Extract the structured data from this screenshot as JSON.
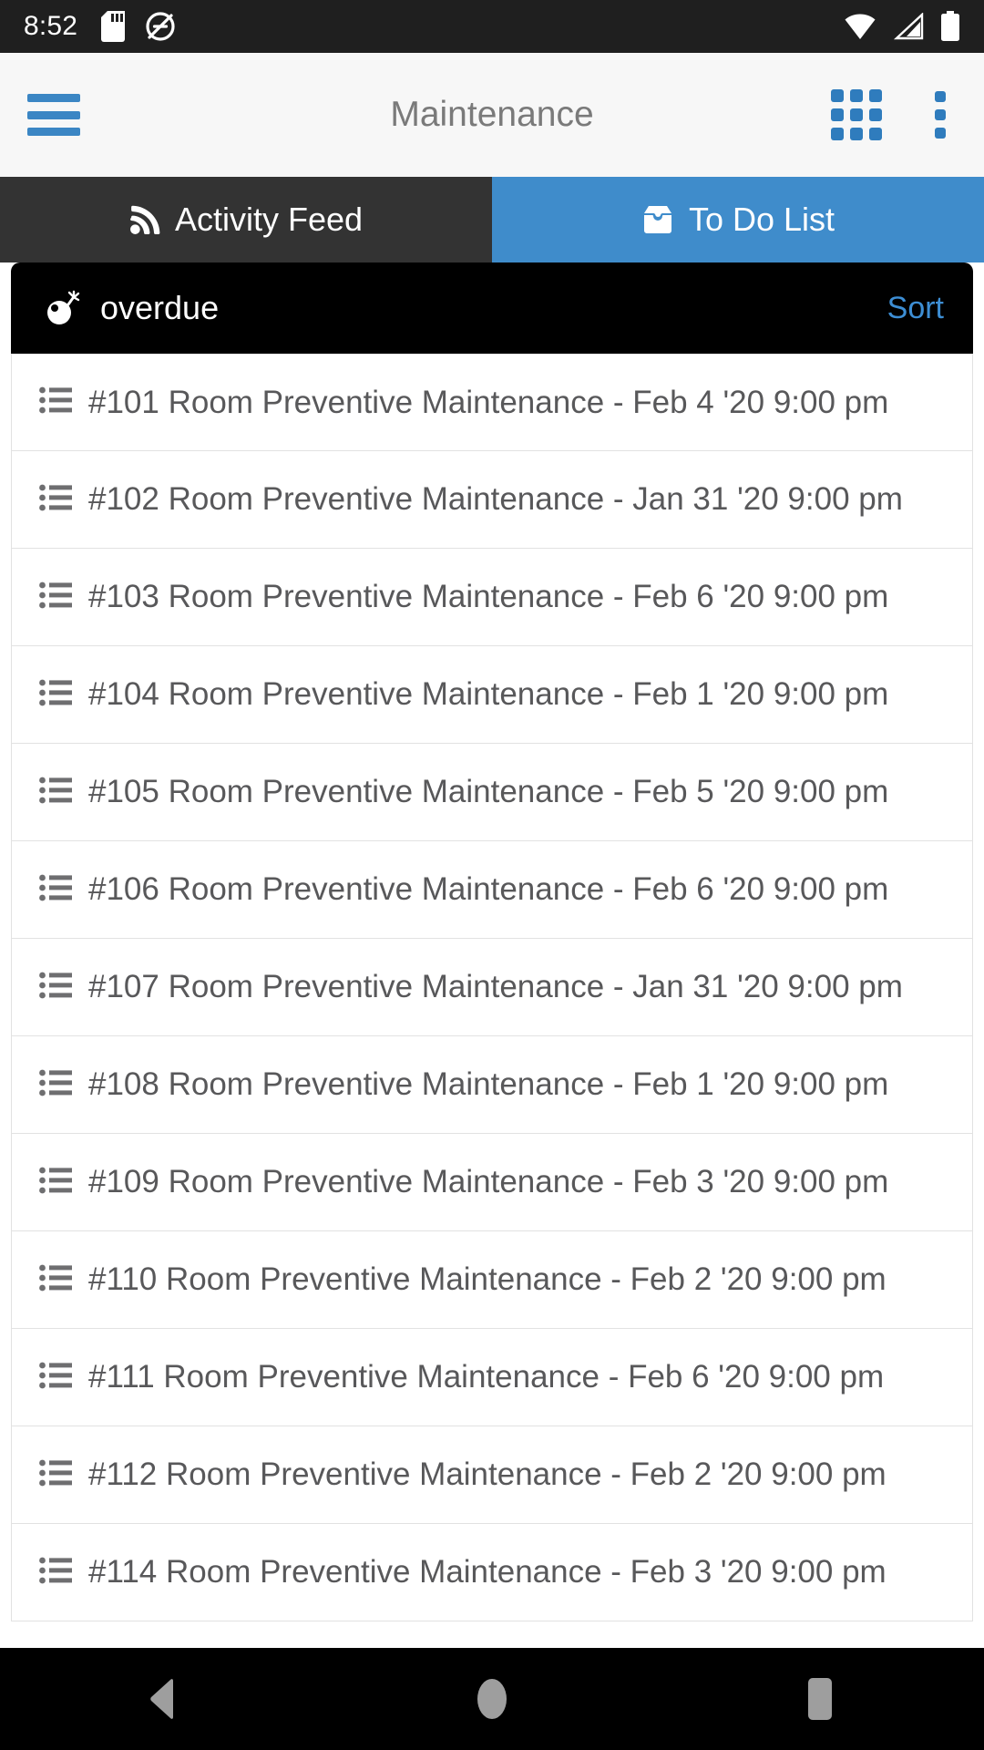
{
  "status_bar": {
    "time": "8:52",
    "left_icons": [
      "sd-card-icon",
      "do-not-disturb-icon"
    ],
    "right_icons": [
      "wifi-icon",
      "cellular-signal-icon",
      "battery-icon"
    ],
    "background_color": "#1f1f1f"
  },
  "app_bar": {
    "menu_icon": "hamburger-menu-icon",
    "title": "Maintenance",
    "grid_icon": "grid-apps-icon",
    "overflow_icon": "overflow-menu-icon",
    "accent_color": "#3b86c4",
    "background_color": "#f7f7f7"
  },
  "tabs": [
    {
      "label": "Activity Feed",
      "icon": "rss-feed-icon",
      "active": false,
      "color": "#333333"
    },
    {
      "label": "To Do List",
      "icon": "inbox-icon",
      "active": true,
      "color": "#3f8ccb"
    }
  ],
  "section": {
    "icon": "bomb-icon",
    "title": "overdue",
    "sort_label": "Sort",
    "sort_color": "#3d8ed4",
    "background_color": "#000000"
  },
  "list": {
    "row_icon": "list-ul-icon",
    "rows": [
      {
        "label": "#101 Room Preventive Maintenance - Feb 4 '20 9:00 pm"
      },
      {
        "label": "#102 Room Preventive Maintenance - Jan 31 '20 9:00 pm"
      },
      {
        "label": "#103 Room Preventive Maintenance - Feb 6 '20 9:00 pm"
      },
      {
        "label": "#104 Room Preventive Maintenance - Feb 1 '20 9:00 pm"
      },
      {
        "label": "#105 Room Preventive Maintenance - Feb 5 '20 9:00 pm"
      },
      {
        "label": "#106 Room Preventive Maintenance - Feb 6 '20 9:00 pm"
      },
      {
        "label": "#107 Room Preventive Maintenance - Jan 31 '20 9:00 pm"
      },
      {
        "label": "#108 Room Preventive Maintenance - Feb 1 '20 9:00 pm"
      },
      {
        "label": "#109 Room Preventive Maintenance - Feb 3 '20 9:00 pm"
      },
      {
        "label": "#110 Room Preventive Maintenance - Feb 2 '20 9:00 pm"
      },
      {
        "label": "#111 Room Preventive Maintenance - Feb 6 '20 9:00 pm"
      },
      {
        "label": "#112 Room Preventive Maintenance - Feb 2 '20 9:00 pm"
      },
      {
        "label": "#114 Room Preventive Maintenance - Feb 3 '20 9:00 pm"
      }
    ]
  },
  "nav_bar": {
    "buttons": [
      "back-button",
      "home-button",
      "recents-button"
    ],
    "background_color": "#000000",
    "icon_color": "#9e9e9e"
  }
}
